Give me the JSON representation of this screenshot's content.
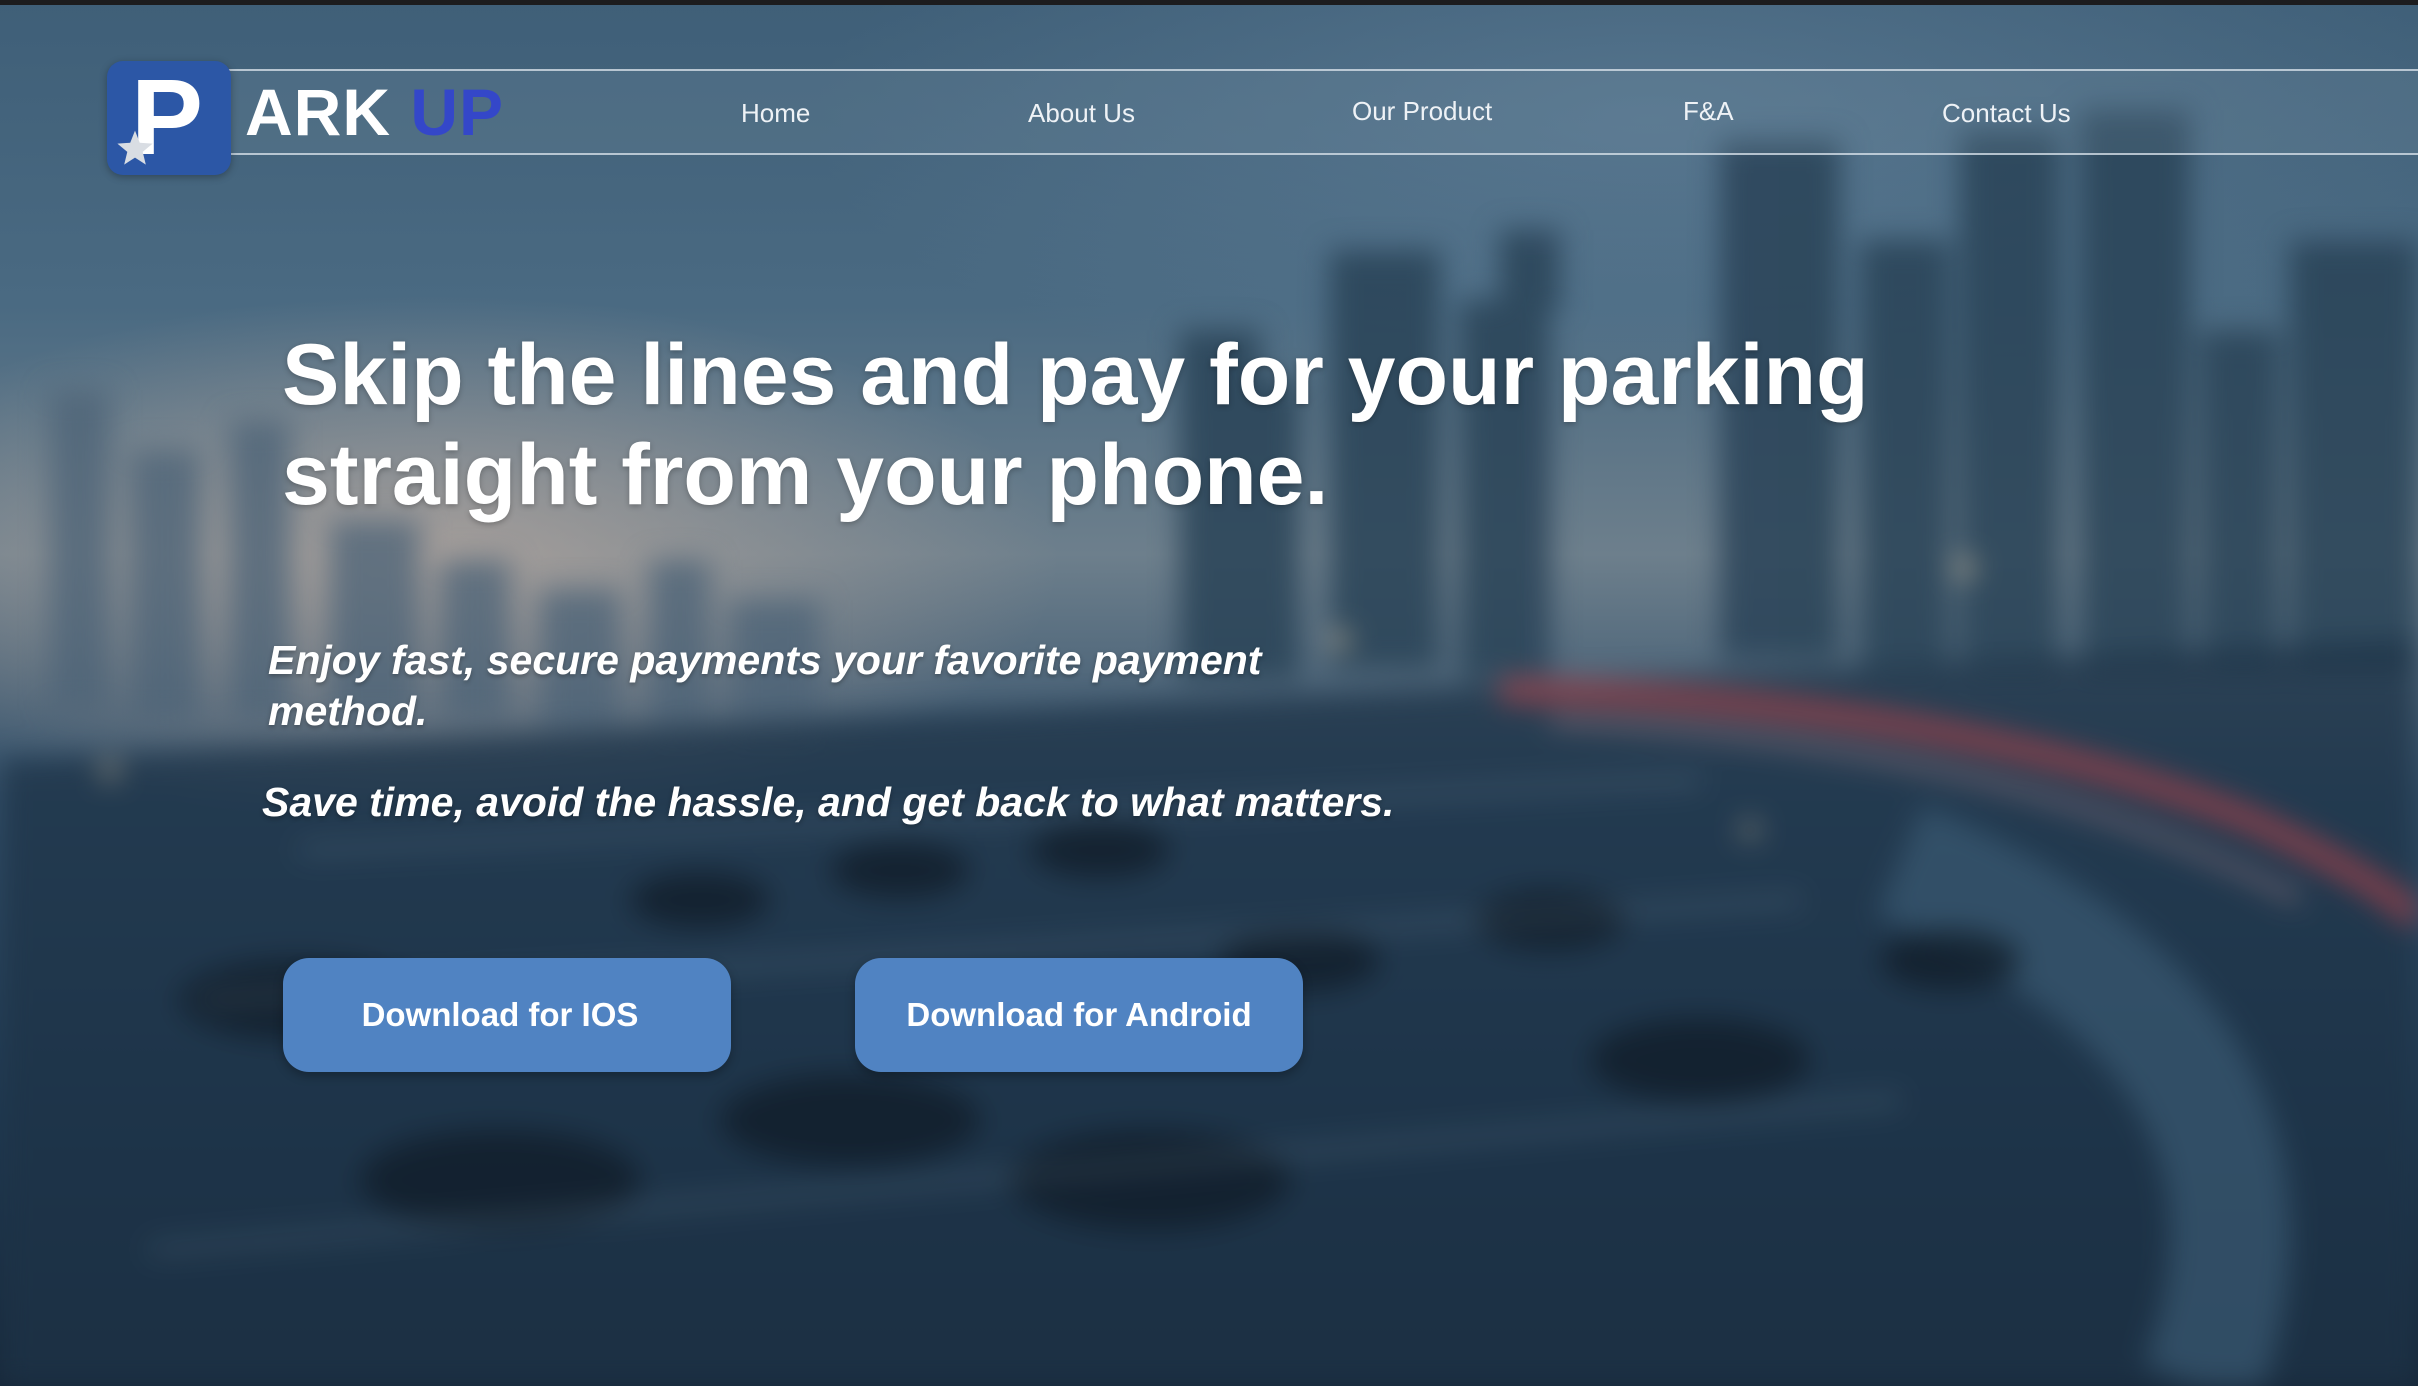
{
  "brand": {
    "logo_letter": "P",
    "name_part1": "ARK",
    "name_part2": "UP",
    "colors": {
      "logo_bg": "#2c57a6",
      "name_accent": "#3447c9"
    },
    "icons": [
      "parking-p-icon",
      "star-icon"
    ]
  },
  "nav": {
    "items": [
      {
        "label": "Home"
      },
      {
        "label": "About Us"
      },
      {
        "label": "Our Product"
      },
      {
        "label": "F&A"
      },
      {
        "label": "Contact Us"
      }
    ]
  },
  "hero": {
    "title": "Skip the lines and pay for your parking straight from your phone.",
    "subtitle_1": "Enjoy fast, secure payments your favorite payment method.",
    "subtitle_2": "Save time, avoid the hassle, and get back to what matters."
  },
  "buttons": {
    "ios_label": "Download for IOS",
    "android_label": "Download for Android",
    "color": "#5083c2"
  }
}
